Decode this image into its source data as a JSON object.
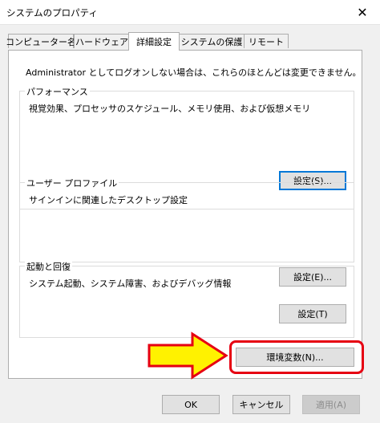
{
  "window": {
    "title": "システムのプロパティ",
    "close_glyph": "✕"
  },
  "tabs": [
    {
      "label": "コンピューター名",
      "active": false
    },
    {
      "label": "ハードウェア",
      "active": false
    },
    {
      "label": "詳細設定",
      "active": true
    },
    {
      "label": "システムの保護",
      "active": false
    },
    {
      "label": "リモート",
      "active": false
    }
  ],
  "notice": "Administrator としてログオンしない場合は、これらのほとんどは変更できません。",
  "groups": {
    "performance": {
      "title": "パフォーマンス",
      "description": "視覚効果、プロセッサのスケジュール、メモリ使用、および仮想メモリ",
      "button": "設定(S)..."
    },
    "profile": {
      "title": "ユーザー プロファイル",
      "description": "サインインに関連したデスクトップ設定",
      "button": "設定(E)..."
    },
    "startup": {
      "title": "起動と回復",
      "description": "システム起動、システム障害、およびデバッグ情報",
      "button": "設定(T)"
    }
  },
  "env_button": "環境変数(N)...",
  "footer": {
    "ok": "OK",
    "cancel": "キャンセル",
    "apply": "適用(A)"
  },
  "annotation": {
    "arrow_fill": "#fff200",
    "outline_color": "#e60012"
  }
}
